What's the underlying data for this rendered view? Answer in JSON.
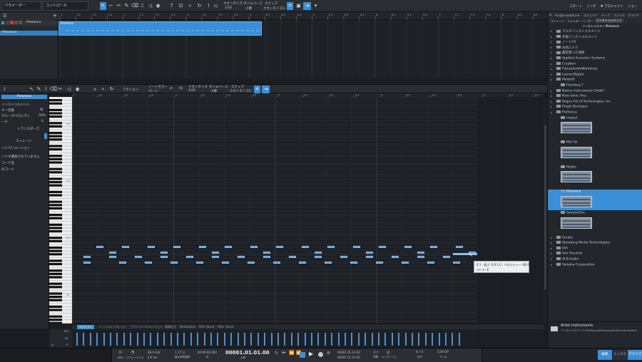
{
  "topbar": {
    "left_dropdown": "パラメーター",
    "control_dropdown": "コントロール",
    "quantize_label": "クオンタイズ",
    "quantize_value": "1/16",
    "timebase_label": "タイムベース",
    "timebase_value": "小節",
    "snap_label": "スナップ",
    "snap_value": "クオンタイズに",
    "right_start": "スタート",
    "right_song": "ソング",
    "right_project": "▼ プロジェクト",
    "right_show": "ショー"
  },
  "track": {
    "name": "Presence",
    "instrument": "Presence",
    "buttons": [
      "M",
      "S",
      "●",
      "◉"
    ]
  },
  "ruler_ticks": [
    "1",
    "1.2",
    "1.3",
    "1.4",
    "2",
    "2.2",
    "2.3",
    "2.4",
    "3",
    "3.2",
    "3.3",
    "3.4",
    "4",
    "4.2",
    "4.3",
    "4.4",
    "5",
    "5.2",
    "5.3",
    "5.4",
    "6",
    "6.2",
    "6.3",
    "6.4",
    "7",
    "7.2",
    "7.3",
    "7.4",
    "8",
    "8.2",
    "8.3"
  ],
  "editor_toolbar": {
    "action": "アクション",
    "note_color_label": "ノートカラー",
    "note_color_value": "パート",
    "quantize_label": "クオンタイズ",
    "quantize_value": "1/16",
    "timebase_label": "タイムベース",
    "timebase_value": "小節",
    "snap_label": "スナップ",
    "snap_value": "クオンタイズに"
  },
  "inspector": {
    "instrument_dropdown": "Presence",
    "rows": [
      "インストゥルメント",
      "キー切替",
      "グルーヴベロシティ",
      "ール",
      "トランスポーズ",
      "ストレート",
      "ンドパリエーション",
      "ンドが選択されていません",
      "コード名",
      "のコード"
    ],
    "percent": "50%",
    "values": [
      "W",
      "0"
    ]
  },
  "piano": {
    "octave_labels": [
      "C4",
      "C3",
      "C2",
      "C1"
    ]
  },
  "tooltip": {
    "line1": "E 1 · 長さ: 0.0.1.0 · ベロシティー: 80.0%",
    "line2": "コード: E"
  },
  "bottom_tabs": [
    "ベロシティ",
    "ノートコントローラー",
    "サウンドバリエーション",
    "演奏記号",
    "Modulation",
    "Pitch Bend",
    "After Touch"
  ],
  "velocity_scale": [
    "100",
    "50",
    "0"
  ],
  "transport": {
    "midi_label": "MIDI",
    "performance_label": "パフォーマンス",
    "sample_rate": "48.0 kHz",
    "latency": "0.0 ms",
    "record_max": "1.17 日",
    "record_max_label": "最大録音時間",
    "time_secondary": "00:00:00.000",
    "time_secondary_label": "秒",
    "position_main": "00001.01.01.00",
    "position_label": "小節",
    "loop_start": "00001.01.01.00",
    "loop_end": "00001.01.01.00",
    "off": "オフ",
    "sync": "同期",
    "metronome": "メトロノーム",
    "time_sig": "4 / 4",
    "time_sig_label": "拍子",
    "tempo": "120.00",
    "tempo_label": "テンポ"
  },
  "footer_buttons": [
    "編集",
    "ミックス",
    "ブラウズ"
  ],
  "browser": {
    "tabs": [
      "インストゥルメント",
      "エフェクト",
      "ループ",
      "ファイル",
      "クラウド"
    ],
    "subtabs": [
      "インストゥルメント",
      "Presence"
    ],
    "filters": [
      "ストレート",
      "フォルダー",
      "ベンダー"
    ],
    "items": [
      "マルチインストゥルメント",
      "外部インストゥルメント",
      "ノートFX",
      "お気に入り",
      "最近使った項目",
      "Applied Acoustics Systems",
      "Cryption",
      "FutureAudioWorkshop",
      "LennarDigital",
      "Modartt",
      "Pianoteq 7",
      "Native Instruments GmbH",
      "New Sonic Arts",
      "Rogue Art of Technologies, Inc",
      "Plugin Boutique",
      "PreSonus",
      "Impact",
      "Mai Tai",
      "Mojito",
      "Presence",
      "SampleOne",
      "Serato",
      "Steinberg Media Technologies",
      "UVI",
      "Vier Records",
      "XLN Audio",
      "Yamaha Corporation"
    ],
    "selected": "Presence",
    "footer_title": "Artist Instruments",
    "footer_path": "インストゥルメント/PreSonus/Presence/Artist Instruments"
  },
  "colors": {
    "accent": "#3a8fd6",
    "note": "#4f8fd1",
    "background": "#1a1d21"
  }
}
